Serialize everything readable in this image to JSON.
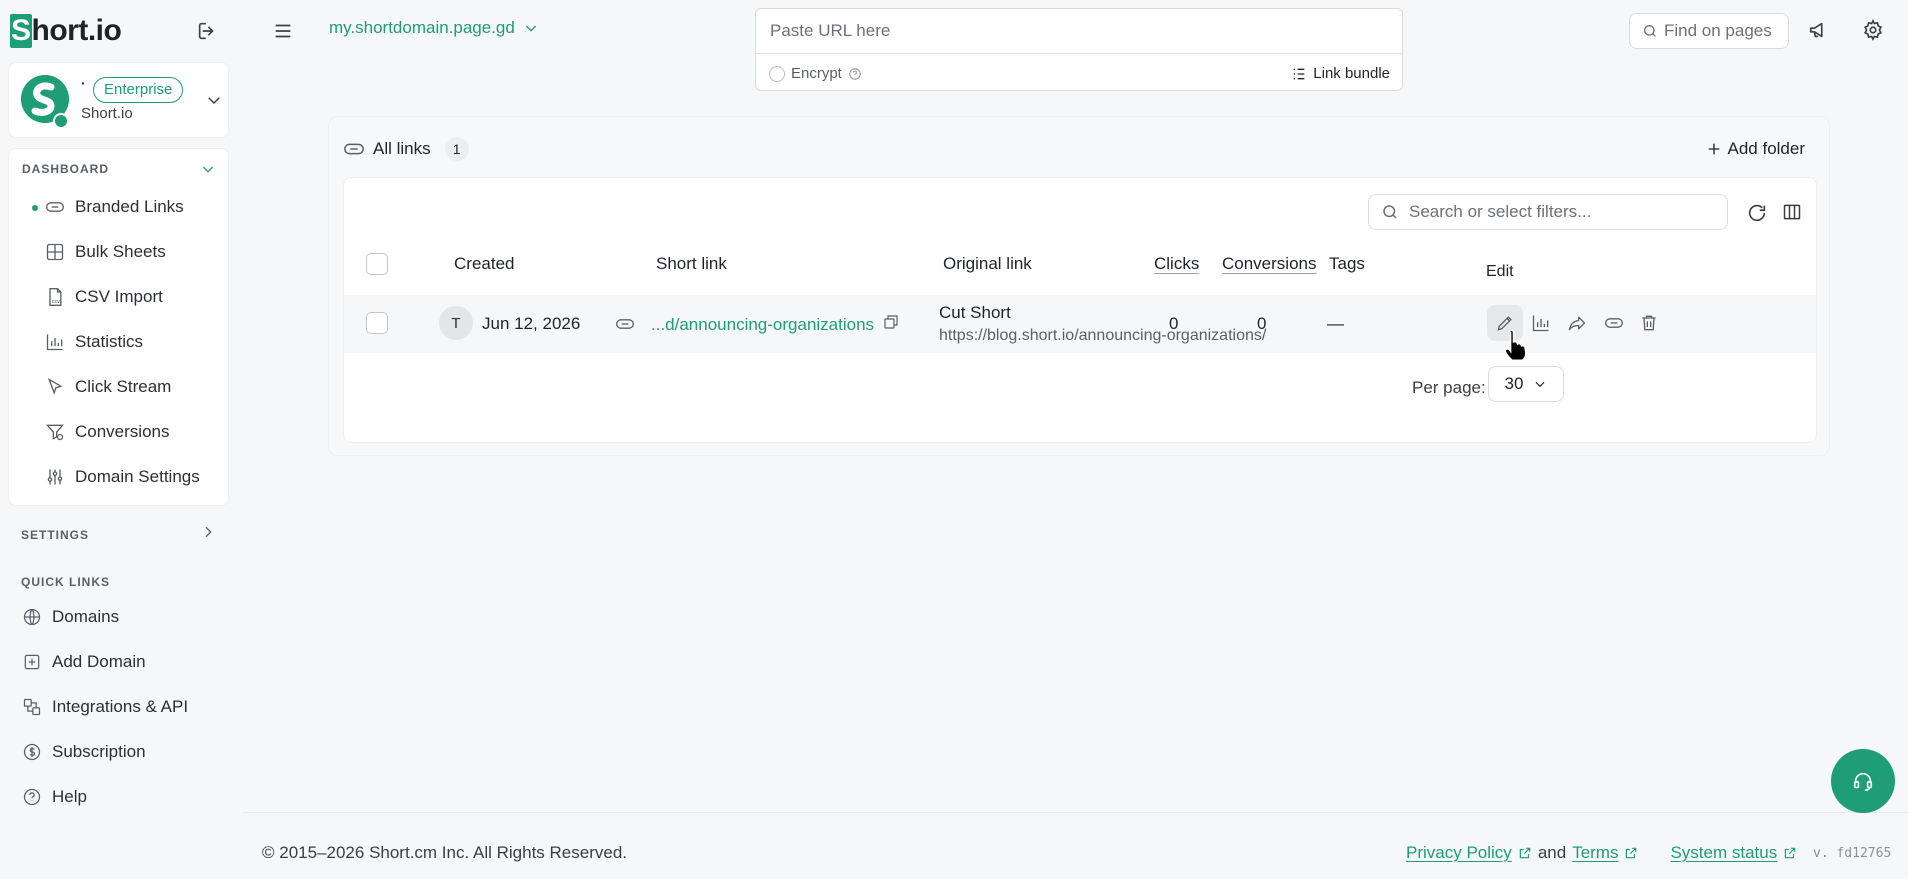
{
  "brand": {
    "logo_first": "S",
    "logo_rest": "hort.io",
    "accent": "#1f9d74"
  },
  "account": {
    "dot": "·",
    "plan_badge": "Enterprise",
    "name": "Short.io"
  },
  "sidebar": {
    "dashboard_title": "DASHBOARD",
    "dashboard_items": [
      {
        "label": "Branded Links",
        "icon": "link-icon"
      },
      {
        "label": "Bulk Sheets",
        "icon": "grid-icon"
      },
      {
        "label": "CSV Import",
        "icon": "csv-file-icon"
      },
      {
        "label": "Statistics",
        "icon": "bar-chart-icon"
      },
      {
        "label": "Click Stream",
        "icon": "cursor-icon"
      },
      {
        "label": "Conversions",
        "icon": "funnel-icon"
      },
      {
        "label": "Domain Settings",
        "icon": "sliders-icon"
      }
    ],
    "settings_title": "SETTINGS",
    "quick_links_title": "QUICK LINKS",
    "quick_links": [
      {
        "label": "Domains",
        "icon": "www-icon"
      },
      {
        "label": "Add Domain",
        "icon": "plus-square-icon"
      },
      {
        "label": "Integrations & API",
        "icon": "integrations-icon"
      },
      {
        "label": "Subscription",
        "icon": "dollar-icon"
      },
      {
        "label": "Help",
        "icon": "help-icon"
      }
    ]
  },
  "topbar": {
    "domain": "my.shortdomain.page.gd",
    "url_placeholder": "Paste URL here",
    "encrypt_label": "Encrypt",
    "bundle_label": "Link bundle",
    "find_placeholder": "Find on pages"
  },
  "links": {
    "title": "All links",
    "count": "1",
    "add_folder": "Add folder",
    "search_placeholder": "Search or select filters...",
    "columns": {
      "created": "Created",
      "short": "Short link",
      "original": "Original link",
      "clicks": "Clicks",
      "conversions": "Conversions",
      "tags": "Tags"
    },
    "rows": [
      {
        "avatar": "T",
        "created": "Jun 12, 2026",
        "short_link": "...d/announcing-organizations",
        "title": "Cut Short",
        "original_url": "https://blog.short.io/announcing-organizations/",
        "clicks": "0",
        "conversions": "0",
        "tags": "—"
      }
    ],
    "tooltip": "Edit",
    "per_page_label": "Per page:",
    "per_page_value": "30"
  },
  "footer": {
    "copyright": "© 2015–2026 Short.cm Inc. All Rights Reserved.",
    "privacy": "Privacy Policy",
    "and": "and",
    "terms": "Terms",
    "status": "System status",
    "version": "v. fd12765"
  }
}
